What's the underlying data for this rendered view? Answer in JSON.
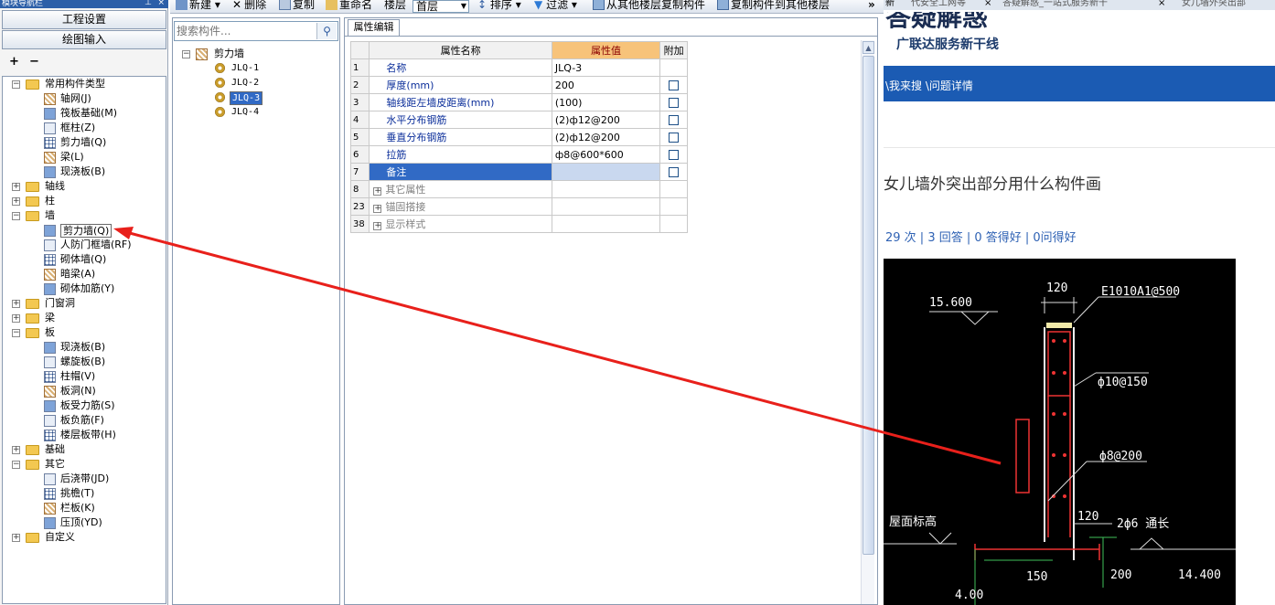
{
  "nav": {
    "title": "模块导航栏",
    "pin_icon": "⊥",
    "close_icon": "×",
    "btn_project": "工程设置",
    "btn_draw": "绘图输入",
    "tools": [
      "+",
      "−"
    ],
    "tree": [
      {
        "label": "常用构件类型",
        "type": "folder",
        "expanded": true
      },
      {
        "label": "轴网(J)",
        "type": "item"
      },
      {
        "label": "筏板基础(M)",
        "type": "item"
      },
      {
        "label": "框柱(Z)",
        "type": "item"
      },
      {
        "label": "剪力墙(Q)",
        "type": "item"
      },
      {
        "label": "梁(L)",
        "type": "item"
      },
      {
        "label": "现浇板(B)",
        "type": "item"
      },
      {
        "label": "轴线",
        "type": "folder",
        "expanded": false
      },
      {
        "label": "柱",
        "type": "folder",
        "expanded": false
      },
      {
        "label": "墙",
        "type": "folder",
        "expanded": true
      },
      {
        "label": "剪力墙(Q)",
        "type": "item",
        "selected": true
      },
      {
        "label": "人防门框墙(RF)",
        "type": "item"
      },
      {
        "label": "砌体墙(Q)",
        "type": "item"
      },
      {
        "label": "暗梁(A)",
        "type": "item"
      },
      {
        "label": "砌体加筋(Y)",
        "type": "item"
      },
      {
        "label": "门窗洞",
        "type": "folder",
        "expanded": false
      },
      {
        "label": "梁",
        "type": "folder",
        "expanded": false
      },
      {
        "label": "板",
        "type": "folder",
        "expanded": true
      },
      {
        "label": "现浇板(B)",
        "type": "item"
      },
      {
        "label": "螺旋板(B)",
        "type": "item"
      },
      {
        "label": "柱帽(V)",
        "type": "item"
      },
      {
        "label": "板洞(N)",
        "type": "item"
      },
      {
        "label": "板受力筋(S)",
        "type": "item"
      },
      {
        "label": "板负筋(F)",
        "type": "item"
      },
      {
        "label": "楼层板带(H)",
        "type": "item"
      },
      {
        "label": "基础",
        "type": "folder",
        "expanded": false
      },
      {
        "label": "其它",
        "type": "folder",
        "expanded": true
      },
      {
        "label": "后浇带(JD)",
        "type": "item"
      },
      {
        "label": "挑檐(T)",
        "type": "item"
      },
      {
        "label": "栏板(K)",
        "type": "item"
      },
      {
        "label": "压顶(YD)",
        "type": "item"
      },
      {
        "label": "自定义",
        "type": "folder",
        "expanded": false
      }
    ]
  },
  "toolbar": {
    "new": "新建",
    "delete": "删除",
    "copy": "复制",
    "rename": "重命名",
    "floor_label": "楼层",
    "floor_value": "首层",
    "sort": "排序",
    "filter": "过滤",
    "copy_from": "从其他楼层复制构件",
    "copy_to": "复制构件到其他楼层",
    "overflow": "»"
  },
  "complist": {
    "search_placeholder": "搜索构件...",
    "root": "剪力墙",
    "items": [
      "JLQ-1",
      "JLQ-2",
      "JLQ-3",
      "JLQ-4"
    ],
    "selected_index": 2
  },
  "props": {
    "tab": "属性编辑",
    "headers": {
      "name": "属性名称",
      "value": "属性值",
      "extra": "附加"
    },
    "rows": [
      {
        "num": "1",
        "name": "名称",
        "value": "JLQ-3",
        "check": false
      },
      {
        "num": "2",
        "name": "厚度(mm)",
        "value": "200",
        "check": true
      },
      {
        "num": "3",
        "name": "轴线距左墙皮距离(mm)",
        "value": "(100)",
        "check": true
      },
      {
        "num": "4",
        "name": "水平分布钢筋",
        "value": "(2)ф12@200",
        "check": true
      },
      {
        "num": "5",
        "name": "垂直分布钢筋",
        "value": "(2)ф12@200",
        "check": true
      },
      {
        "num": "6",
        "name": "拉筋",
        "value": "ф8@600*600",
        "check": true
      },
      {
        "num": "7",
        "name": "备注",
        "value": "",
        "check": true,
        "selected": true
      },
      {
        "num": "8",
        "name": "其它属性",
        "value": "",
        "group": true
      },
      {
        "num": "23",
        "name": "锚固搭接",
        "value": "",
        "group": true
      },
      {
        "num": "38",
        "name": "显示样式",
        "value": "",
        "group": true
      }
    ]
  },
  "browser": {
    "tabs": [
      "新",
      "代安全工网等",
      "×",
      "答疑解惑_一站式服务新干",
      "×",
      "女儿墙外突出部"
    ],
    "logo": "答疑解惑",
    "slogan": "广联达服务新干线",
    "breadcrumb": "\\我来搜 \\问题详情",
    "question": "女儿墙外突出部分用什么构件画",
    "stats": "29 次 | 3 回答 | 0 答得好 | 0问得好",
    "cad_labels": {
      "top_width": "120",
      "stirrup": "E1010A1@500",
      "elev_top": "15.600",
      "tie1": "ф10@150",
      "tie2": "ф8@200",
      "roof": "屋面标高",
      "width2": "120",
      "bars": "2ф6 通长",
      "w150": "150",
      "h200": "200",
      "elev_low": "14.400",
      "partial": "4.00"
    }
  },
  "colors": {
    "arrow": "#e8201b",
    "accent_blue": "#1b5bb3",
    "header_orange": "#f7c37a"
  }
}
